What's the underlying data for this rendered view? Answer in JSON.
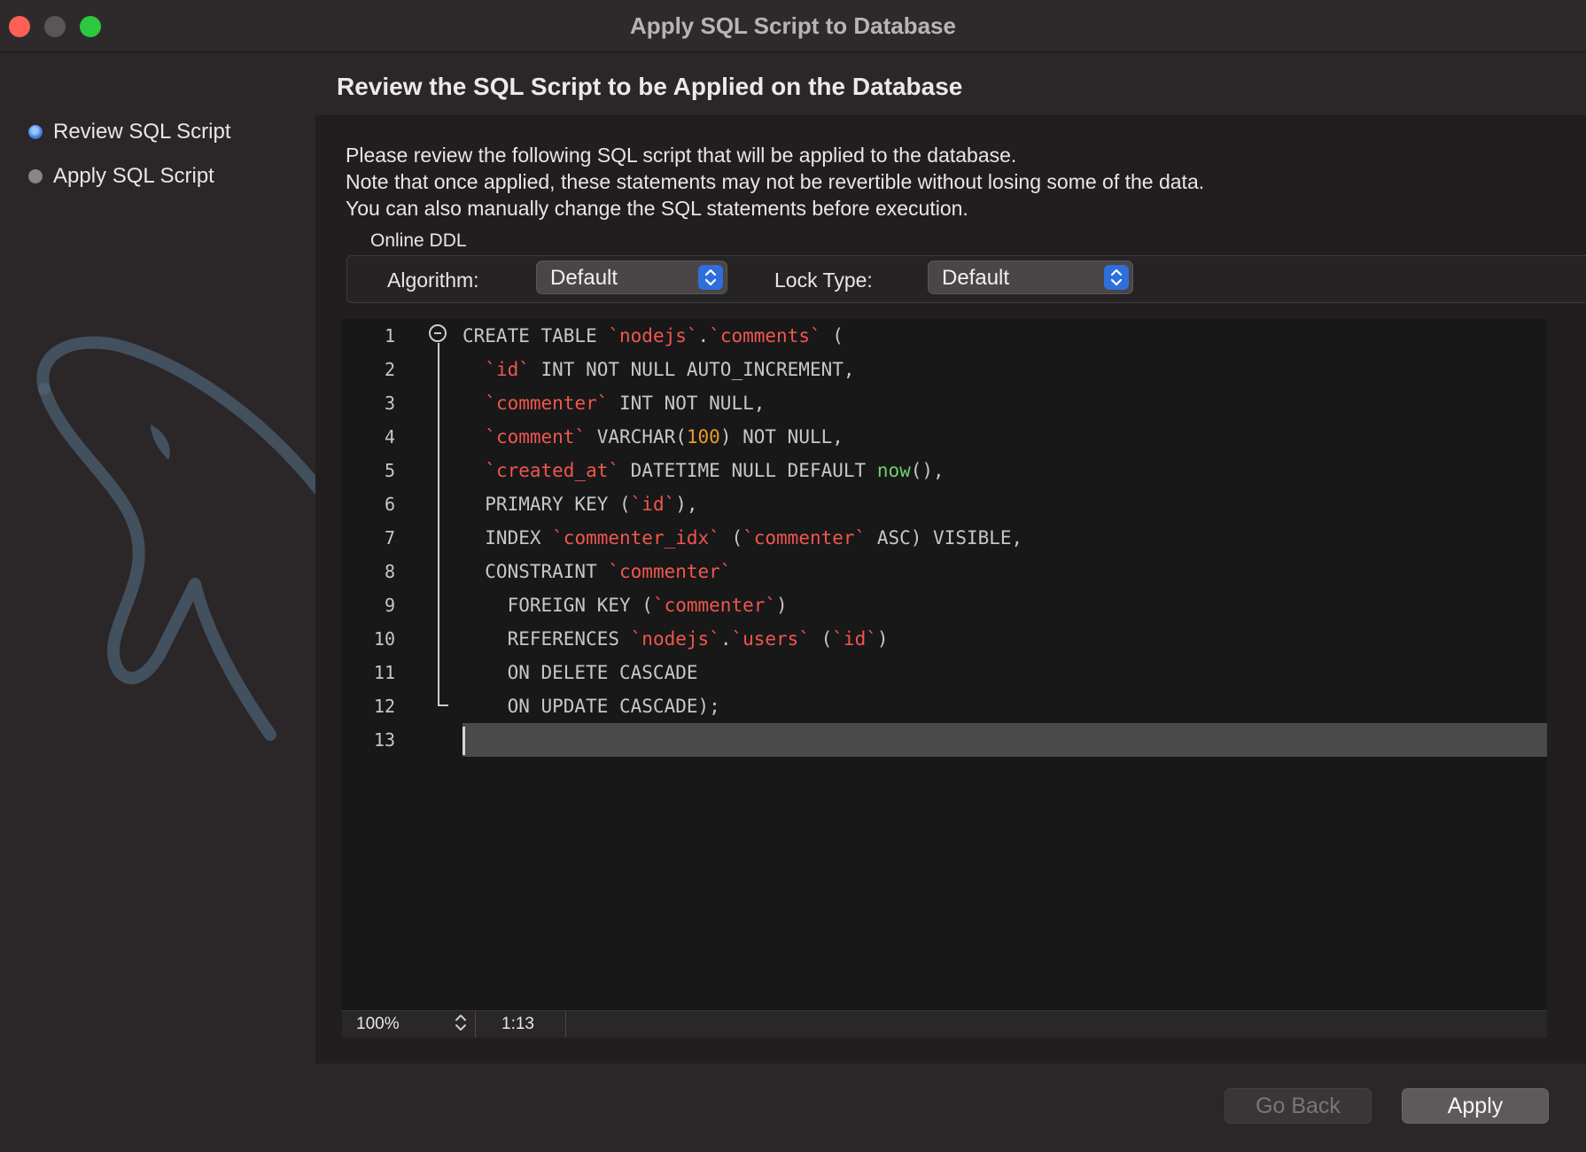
{
  "window": {
    "title": "Apply SQL Script to Database"
  },
  "steps": [
    {
      "label": "Review SQL Script",
      "active": true
    },
    {
      "label": "Apply SQL Script",
      "active": false
    }
  ],
  "heading": "Review the SQL Script to be Applied on the Database",
  "description": [
    "Please review the following SQL script that will be applied to the database.",
    "Note that once applied, these statements may not be revertible without losing some of the data.",
    "You can also manually change the SQL statements before execution."
  ],
  "online_ddl": {
    "title": "Online DDL",
    "algorithm_label": "Algorithm:",
    "algorithm_value": "Default",
    "lock_type_label": "Lock Type:",
    "lock_type_value": "Default"
  },
  "editor": {
    "line_numbers": [
      "1",
      "2",
      "3",
      "4",
      "5",
      "6",
      "7",
      "8",
      "9",
      "10",
      "11",
      "12",
      "13"
    ],
    "lines": [
      [
        {
          "t": "CREATE TABLE ",
          "c": "kw"
        },
        {
          "t": "`nodejs`",
          "c": "id"
        },
        {
          "t": ".",
          "c": "kw"
        },
        {
          "t": "`comments`",
          "c": "id"
        },
        {
          "t": " (",
          "c": "kw"
        }
      ],
      [
        {
          "t": "  ",
          "c": "kw"
        },
        {
          "t": "`id`",
          "c": "id"
        },
        {
          "t": " INT NOT NULL AUTO_INCREMENT,",
          "c": "kw"
        }
      ],
      [
        {
          "t": "  ",
          "c": "kw"
        },
        {
          "t": "`commenter`",
          "c": "id"
        },
        {
          "t": " INT NOT NULL,",
          "c": "kw"
        }
      ],
      [
        {
          "t": "  ",
          "c": "kw"
        },
        {
          "t": "`comment`",
          "c": "id"
        },
        {
          "t": " VARCHAR(",
          "c": "kw"
        },
        {
          "t": "100",
          "c": "num"
        },
        {
          "t": ") NOT NULL,",
          "c": "kw"
        }
      ],
      [
        {
          "t": "  ",
          "c": "kw"
        },
        {
          "t": "`created_at`",
          "c": "id"
        },
        {
          "t": " DATETIME NULL DEFAULT ",
          "c": "kw"
        },
        {
          "t": "now",
          "c": "fn"
        },
        {
          "t": "(),",
          "c": "kw"
        }
      ],
      [
        {
          "t": "  PRIMARY KEY (",
          "c": "kw"
        },
        {
          "t": "`id`",
          "c": "id"
        },
        {
          "t": "),",
          "c": "kw"
        }
      ],
      [
        {
          "t": "  INDEX ",
          "c": "kw"
        },
        {
          "t": "`commenter_idx`",
          "c": "id"
        },
        {
          "t": " (",
          "c": "kw"
        },
        {
          "t": "`commenter`",
          "c": "id"
        },
        {
          "t": " ASC) VISIBLE,",
          "c": "kw"
        }
      ],
      [
        {
          "t": "  CONSTRAINT ",
          "c": "kw"
        },
        {
          "t": "`commenter`",
          "c": "id"
        }
      ],
      [
        {
          "t": "    FOREIGN KEY (",
          "c": "kw"
        },
        {
          "t": "`commenter`",
          "c": "id"
        },
        {
          "t": ")",
          "c": "kw"
        }
      ],
      [
        {
          "t": "    REFERENCES ",
          "c": "kw"
        },
        {
          "t": "`nodejs`",
          "c": "id"
        },
        {
          "t": ".",
          "c": "kw"
        },
        {
          "t": "`users`",
          "c": "id"
        },
        {
          "t": " (",
          "c": "kw"
        },
        {
          "t": "`id`",
          "c": "id"
        },
        {
          "t": ")",
          "c": "kw"
        }
      ],
      [
        {
          "t": "    ON DELETE CASCADE",
          "c": "kw"
        }
      ],
      [
        {
          "t": "    ON UPDATE CASCADE);",
          "c": "kw"
        }
      ],
      []
    ]
  },
  "status": {
    "zoom": "100%",
    "position": "1:13"
  },
  "buttons": {
    "back": "Go Back",
    "apply": "Apply"
  },
  "colors": {
    "close": "#fe5f57",
    "minimize": "#5a5557",
    "maximize": "#2bc840",
    "identifier": "#f0564f",
    "number": "#e89a2e",
    "function": "#6fcf6f",
    "accent": "#2f6fdc"
  }
}
